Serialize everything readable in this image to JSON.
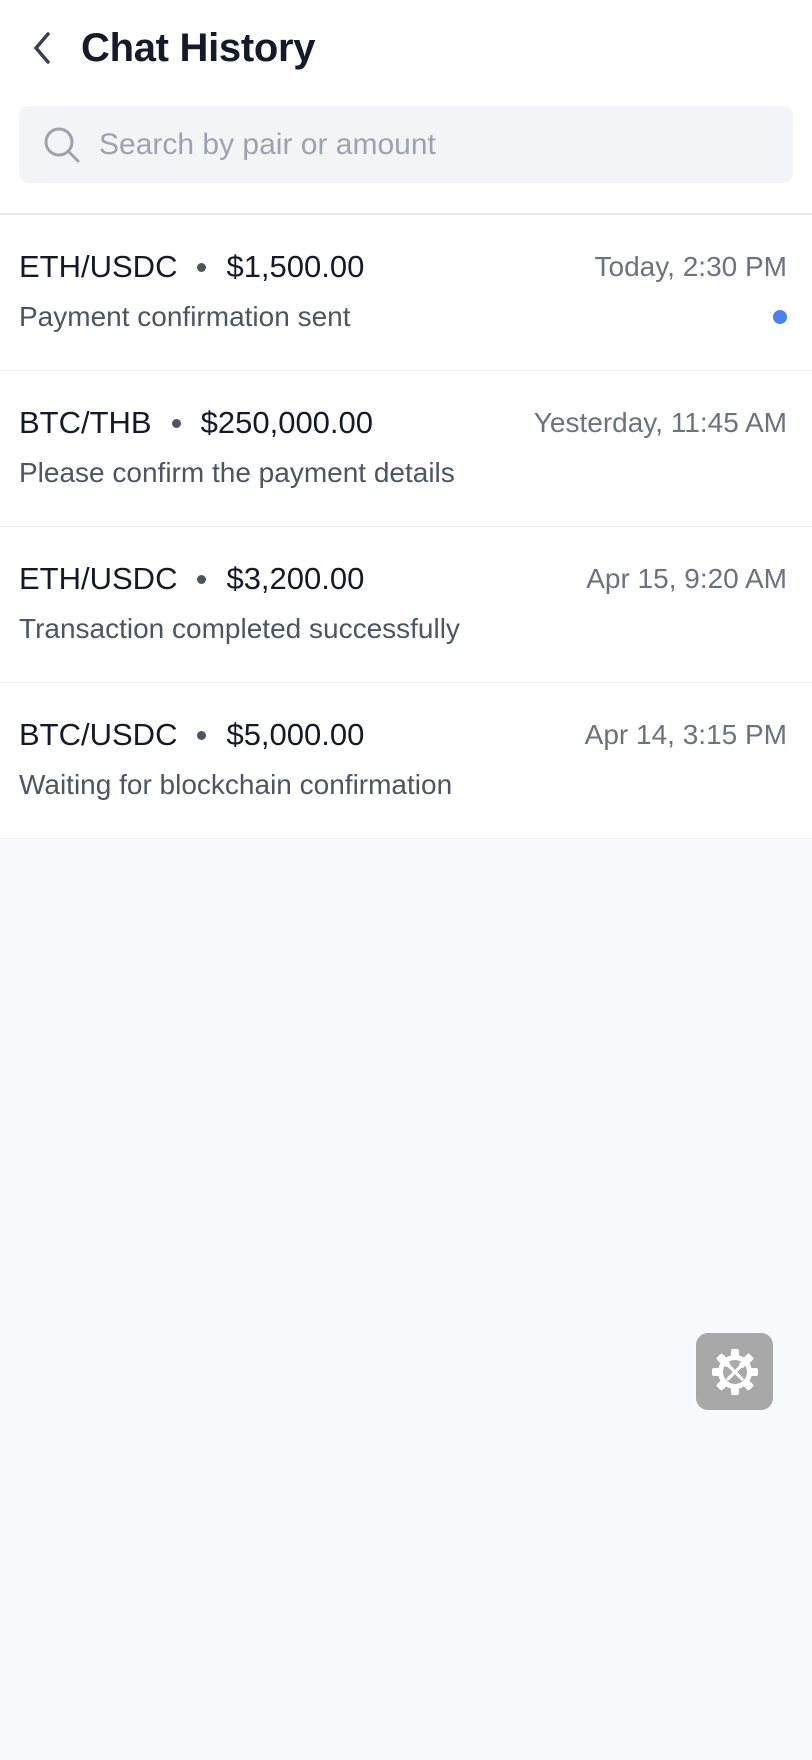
{
  "header": {
    "title": "Chat History"
  },
  "search": {
    "placeholder": "Search by pair or amount",
    "value": ""
  },
  "chats": [
    {
      "pair": "ETH/USDC",
      "amount": "$1,500.00",
      "time": "Today, 2:30 PM",
      "message": "Payment confirmation sent",
      "unread": true
    },
    {
      "pair": "BTC/THB",
      "amount": "$250,000.00",
      "time": "Yesterday, 11:45 AM",
      "message": "Please confirm the payment details",
      "unread": false
    },
    {
      "pair": "ETH/USDC",
      "amount": "$3,200.00",
      "time": "Apr 15, 9:20 AM",
      "message": "Transaction completed successfully",
      "unread": false
    },
    {
      "pair": "BTC/USDC",
      "amount": "$5,000.00",
      "time": "Apr 14, 3:15 PM",
      "message": "Waiting for blockchain confirmation",
      "unread": false
    }
  ],
  "icons": {
    "back": "chevron-left-icon",
    "search": "search-icon",
    "fab": "settings-tools-icon"
  },
  "colors": {
    "unread_indicator": "#4a80ef",
    "background": "#f8f9fb",
    "fab": "#a8a8a8"
  }
}
